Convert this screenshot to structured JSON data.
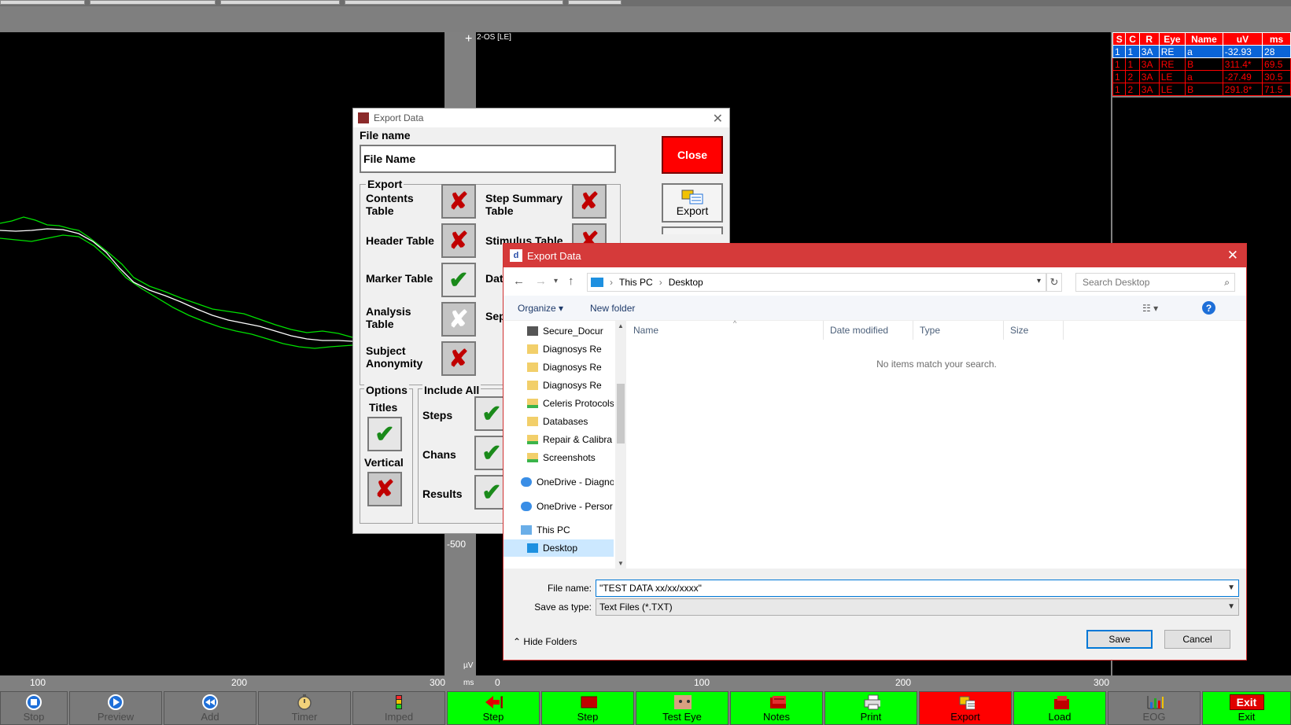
{
  "plot": {
    "channel_label": "2-OS [LE]",
    "plus_marker": "+",
    "y_axis_value": "-500",
    "y_axis_unit": "µV",
    "x_axis_unit": "ms",
    "left_ticks": [
      "100",
      "200",
      "300"
    ],
    "right_ticks": [
      "0",
      "100",
      "200",
      "300"
    ]
  },
  "results": {
    "headers": [
      "S",
      "C",
      "R",
      "Eye",
      "Name",
      "uV",
      "ms"
    ],
    "rows": [
      [
        "1",
        "1",
        "3A",
        "RE",
        "a",
        "-32.93",
        "28"
      ],
      [
        "1",
        "1",
        "3A",
        "RE",
        "B",
        "311.4*",
        "69.5"
      ],
      [
        "1",
        "2",
        "3A",
        "LE",
        "a",
        "-27.49",
        "30.5"
      ],
      [
        "1",
        "2",
        "3A",
        "LE",
        "B",
        "291.8*",
        "71.5"
      ]
    ],
    "selected_row": 0,
    "colors": {
      "header_bg": "#ff0000",
      "text": "#ff0000",
      "selected_bg": "#0a64d8"
    }
  },
  "legacy_dialog": {
    "title": "Export Data",
    "file_name_label": "File name",
    "file_name_value": "File Name",
    "close_label": "Close",
    "export_button_label": "Export",
    "export_group_label": "Export",
    "items": {
      "contents_table": "Contents Table",
      "header_table": "Header Table",
      "marker_table": "Marker Table",
      "analysis_table": "Analysis Table",
      "subject_anonymity": "Subject Anonymity",
      "step_summary_table": "Step Summary Table",
      "stimulus_table": "Stimulus Table",
      "data": "Dat",
      "sep": "Sep"
    },
    "options_label": "Options",
    "titles_label": "Titles",
    "vertical_label": "Vertical",
    "include_all_label": "Include All",
    "steps_label": "Steps",
    "chans_label": "Chans",
    "results_label": "Results"
  },
  "file_dialog": {
    "title": "Export Data",
    "breadcrumb": [
      "This PC",
      "Desktop"
    ],
    "search_placeholder": "Search Desktop",
    "organize_label": "Organize",
    "new_folder_label": "New folder",
    "columns": [
      "Name",
      "Date modified",
      "Type",
      "Size"
    ],
    "empty_message": "No items match your search.",
    "tree": [
      "Secure_Docur",
      "Diagnosys Re",
      "Diagnosys Re",
      "Diagnosys Re",
      "Celeris Protocols",
      "Databases",
      "Repair & Calibra",
      "Screenshots",
      "OneDrive - Diagno",
      "OneDrive - Persor",
      "This PC",
      "Desktop"
    ],
    "file_name_label": "File name:",
    "file_name_value": "\"TEST DATA xx/xx/xxxx\"",
    "save_type_label": "Save as type:",
    "save_type_value": "Text Files (*.TXT)",
    "hide_folders_label": "Hide Folders",
    "save_label": "Save",
    "cancel_label": "Cancel"
  },
  "toolbar": [
    {
      "label": "Stop",
      "style": "grey"
    },
    {
      "label": "Preview",
      "style": "grey"
    },
    {
      "label": "Add",
      "style": "grey"
    },
    {
      "label": "Timer",
      "style": "grey"
    },
    {
      "label": "Imped",
      "style": "grey"
    },
    {
      "label": "Step",
      "style": "green"
    },
    {
      "label": "Step",
      "style": "green"
    },
    {
      "label": "Test Eye",
      "style": "green"
    },
    {
      "label": "Notes",
      "style": "green"
    },
    {
      "label": "Print",
      "style": "green"
    },
    {
      "label": "Export",
      "style": "red"
    },
    {
      "label": "Load",
      "style": "green"
    },
    {
      "label": "EOG",
      "style": "grey"
    },
    {
      "label": "Exit",
      "style": "green"
    }
  ],
  "colors": {
    "trace_green": "#00e000",
    "trace_white": "#ffffff",
    "toolbar_green": "#00ff00",
    "toolbar_red": "#ff0000"
  }
}
